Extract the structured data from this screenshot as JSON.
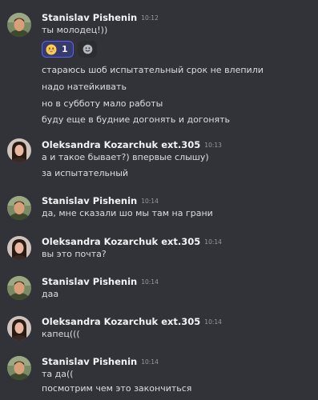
{
  "messages": [
    {
      "author": "Stanislav Pishenin",
      "time": "10:12",
      "lines": [
        "ты молодец!))"
      ],
      "reaction": {
        "emoji": "grinning-face",
        "count": "1"
      },
      "continuation": [
        "стараюсь шоб испытательный срок не влепили",
        "надо натейкивать",
        "но в субботу мало работы",
        "буду еще в будние догонять и догонять"
      ]
    },
    {
      "author": "Oleksandra Kozarchuk ext.305",
      "time": "10:13",
      "lines": [
        "а и такое бывает?) впервые слышу)",
        "за испытательный"
      ]
    },
    {
      "author": "Stanislav Pishenin",
      "time": "10:14",
      "lines": [
        "да, мне сказали шо мы там на грани"
      ]
    },
    {
      "author": "Oleksandra Kozarchuk ext.305",
      "time": "10:14",
      "lines": [
        "вы это почта?"
      ]
    },
    {
      "author": "Stanislav Pishenin",
      "time": "10:14",
      "lines": [
        "даа"
      ]
    },
    {
      "author": "Oleksandra Kozarchuk ext.305",
      "time": "10:14",
      "lines": [
        "капец((("
      ]
    },
    {
      "author": "Stanislav Pishenin",
      "time": "10:14",
      "lines": [
        "та да((",
        "посмотрим чем это закончиться"
      ]
    }
  ],
  "icons": {
    "avatar_stanislav": "male-avatar-photo",
    "avatar_oleksandra": "female-avatar-photo",
    "reaction": "grinning-face-emoji",
    "add_reaction": "add-reaction-smiley-icon"
  },
  "colors": {
    "background": "#313338",
    "author": "#f2f3f5",
    "text": "#dbdee1",
    "timestamp": "#949ba4",
    "reaction_border": "#5865f2",
    "reaction_bg": "#373a6d"
  }
}
